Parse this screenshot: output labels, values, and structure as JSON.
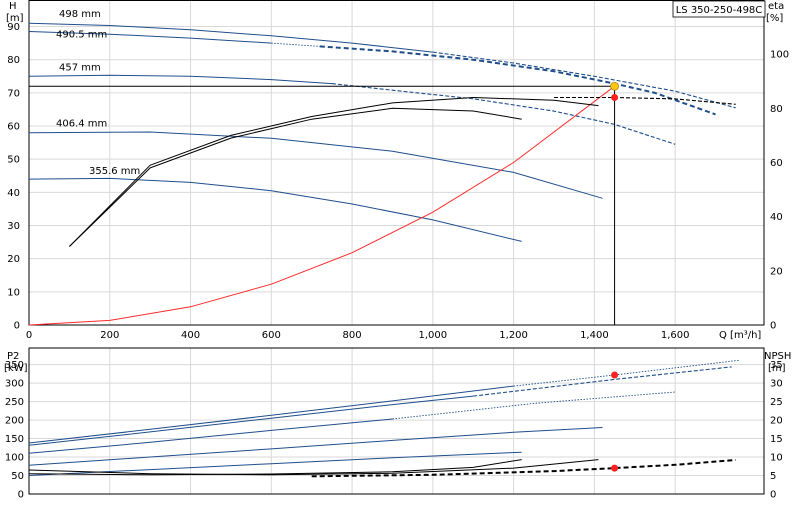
{
  "chart_data": [
    {
      "type": "line",
      "title": "LS 350-250-498C",
      "xlabel": "Q [m³/h]",
      "ylabel_left": {
        "name": "H",
        "unit": "[m]"
      },
      "ylabel_right": {
        "name": "eta",
        "unit": "[%]"
      },
      "xlim": [
        0,
        1820
      ],
      "ylim_left": [
        0,
        98
      ],
      "ylim_right": [
        0,
        120
      ],
      "x_ticks": [
        0,
        200,
        400,
        600,
        800,
        1000,
        1200,
        1400,
        1600
      ],
      "x_tick_labels": [
        "0",
        "200",
        "400",
        "600",
        "800",
        "1,000",
        "1,200",
        "1,400",
        "1,600"
      ],
      "y_ticks_left": [
        0,
        10,
        20,
        30,
        40,
        50,
        60,
        70,
        80,
        90
      ],
      "y_ticks_right": [
        0,
        20,
        40,
        60,
        80,
        100
      ],
      "grid": true,
      "duty_point": {
        "q": 1450,
        "h": 72,
        "eta": 84
      },
      "series": [
        {
          "name": "498 mm",
          "axis": "left",
          "color": "#1f4e8c",
          "style": "solid",
          "x": [
            0,
            200,
            400,
            600,
            800,
            1000
          ],
          "y": [
            91,
            90.3,
            89,
            87.2,
            85,
            82.3
          ]
        },
        {
          "name": "",
          "axis": "left",
          "color": "#1f4e8c",
          "style": "dashed",
          "x": [
            1000,
            1200,
            1400,
            1600,
            1750
          ],
          "y": [
            82.3,
            79,
            75,
            70.5,
            65.5
          ]
        },
        {
          "name": "490.5 mm",
          "axis": "left",
          "color": "#1f4e8c",
          "style": "solid",
          "x": [
            0,
            200,
            400,
            600
          ],
          "y": [
            88.5,
            87.7,
            86.5,
            85
          ]
        },
        {
          "name": "",
          "axis": "left",
          "color": "#1f4e8c",
          "style": "dotted",
          "x": [
            600,
            720
          ],
          "y": [
            85,
            84
          ]
        },
        {
          "name": "",
          "axis": "left",
          "color": "#1f4e8c",
          "style": "dashed-bold",
          "x": [
            720,
            900,
            1100,
            1300,
            1450,
            1550,
            1700
          ],
          "y": [
            84,
            82.5,
            80,
            76.5,
            72.8,
            70,
            63.5
          ]
        },
        {
          "name": "457 mm",
          "axis": "left",
          "color": "#1f4e8c",
          "style": "solid",
          "x": [
            0,
            200,
            400,
            600,
            750
          ],
          "y": [
            75,
            75.3,
            75,
            74,
            72.8
          ]
        },
        {
          "name": "",
          "axis": "left",
          "color": "#1f4e8c",
          "style": "dashed",
          "x": [
            750,
            900,
            1100,
            1300,
            1450,
            1600
          ],
          "y": [
            72.8,
            70.8,
            68.2,
            64.5,
            60.5,
            54.5
          ]
        },
        {
          "name": "406.4 mm",
          "axis": "left",
          "color": "#1f4e8c",
          "style": "solid",
          "x": [
            0,
            300,
            600,
            900,
            1200,
            1420
          ],
          "y": [
            58,
            58.2,
            56.3,
            52.4,
            46,
            38.2
          ]
        },
        {
          "name": "355.6 mm",
          "axis": "left",
          "color": "#1f4e8c",
          "style": "solid",
          "x": [
            0,
            200,
            400,
            600,
            800,
            1000,
            1220
          ],
          "y": [
            44,
            44.2,
            43,
            40.5,
            36.5,
            31.7,
            25.2
          ]
        },
        {
          "name": "",
          "axis": "left",
          "color": "#000000",
          "style": "solid",
          "x": [
            0,
            200,
            400,
            600,
            800,
            1000,
            1200,
            1300,
            1400,
            1450
          ],
          "y": [
            72,
            72,
            72,
            72,
            72,
            72,
            72,
            72,
            72,
            72
          ]
        },
        {
          "name": "",
          "axis": "left",
          "color": "#ff2a2a",
          "style": "solid",
          "x": [
            0,
            200,
            400,
            600,
            800,
            1000,
            1200,
            1450
          ],
          "y": [
            0,
            1.4,
            5.5,
            12.3,
            21.8,
            34,
            49,
            72
          ]
        },
        {
          "name": "",
          "axis": "right",
          "color": "#000000",
          "style": "solid",
          "x": [
            100,
            300,
            500,
            700,
            900,
            1100,
            1300,
            1410
          ],
          "y": [
            29,
            59,
            70,
            77,
            82,
            84,
            83,
            81
          ]
        },
        {
          "name": "",
          "axis": "right",
          "color": "#000000",
          "style": "solid",
          "x": [
            100,
            300,
            500,
            700,
            900,
            1100,
            1220
          ],
          "y": [
            29,
            58,
            69,
            76,
            80,
            79,
            76
          ]
        },
        {
          "name": "",
          "axis": "right",
          "color": "#000000",
          "style": "dashed",
          "x": [
            1300,
            1450,
            1600,
            1750
          ],
          "y": [
            84,
            84,
            83.5,
            81.5
          ]
        }
      ]
    },
    {
      "type": "line",
      "xlabel": "",
      "ylabel_left": {
        "name": "P2",
        "unit": "[kW]"
      },
      "ylabel_right": {
        "name": "NPSH",
        "unit": "[m]"
      },
      "xlim": [
        0,
        1820
      ],
      "ylim_left": [
        0,
        395
      ],
      "ylim_right": [
        0,
        39.5
      ],
      "y_ticks_left": [
        0,
        50,
        100,
        150,
        200,
        250,
        300,
        350
      ],
      "y_ticks_right": [
        0,
        5,
        10,
        15,
        20,
        25,
        30,
        35
      ],
      "grid": true,
      "duty_point": {
        "q": 1450,
        "p2": 322,
        "npsh": 7
      },
      "series": [
        {
          "name": "",
          "axis": "left",
          "color": "#1f4e8c",
          "style": "solid",
          "x": [
            0,
            300,
            600,
            900,
            1200
          ],
          "y": [
            138,
            175,
            213,
            252,
            292
          ]
        },
        {
          "name": "",
          "axis": "left",
          "color": "#1f4e8c",
          "style": "dotted",
          "x": [
            1200,
            1450,
            1760
          ],
          "y": [
            292,
            322,
            362
          ]
        },
        {
          "name": "",
          "axis": "left",
          "color": "#1f4e8c",
          "style": "solid",
          "x": [
            0,
            300,
            600,
            900,
            1100
          ],
          "y": [
            132,
            168,
            205,
            242,
            265
          ]
        },
        {
          "name": "",
          "axis": "left",
          "color": "#1f4e8c",
          "style": "dashed",
          "x": [
            1100,
            1450,
            1740
          ],
          "y": [
            265,
            310,
            344
          ]
        },
        {
          "name": "",
          "axis": "left",
          "color": "#1f4e8c",
          "style": "solid",
          "x": [
            0,
            300,
            600,
            900
          ],
          "y": [
            110,
            140,
            172,
            203
          ]
        },
        {
          "name": "",
          "axis": "left",
          "color": "#1f4e8c",
          "style": "dotted",
          "x": [
            900,
            1250,
            1600
          ],
          "y": [
            203,
            245,
            276
          ]
        },
        {
          "name": "",
          "axis": "left",
          "color": "#1f4e8c",
          "style": "solid",
          "x": [
            0,
            300,
            600,
            900,
            1200,
            1420
          ],
          "y": [
            78,
            100,
            122,
            145,
            167,
            180
          ]
        },
        {
          "name": "",
          "axis": "left",
          "color": "#1f4e8c",
          "style": "solid",
          "x": [
            0,
            300,
            600,
            900,
            1220
          ],
          "y": [
            50,
            66,
            82,
            98,
            113
          ]
        },
        {
          "name": "",
          "axis": "right",
          "color": "#000000",
          "style": "solid",
          "x": [
            0,
            300,
            600,
            900,
            1100,
            1220
          ],
          "y": [
            5.5,
            5.2,
            5.4,
            6,
            7.2,
            9.3
          ]
        },
        {
          "name": "",
          "axis": "right",
          "color": "#000000",
          "style": "solid",
          "x": [
            0,
            300,
            600,
            900,
            1200,
            1410
          ],
          "y": [
            6.5,
            5.5,
            5.2,
            5.6,
            7,
            9.3
          ]
        },
        {
          "name": "",
          "axis": "right",
          "color": "#000000",
          "style": "dashed-bold",
          "x": [
            700,
            1000,
            1300,
            1450,
            1600,
            1750
          ],
          "y": [
            4.8,
            5.2,
            6.2,
            7,
            7.9,
            9.2
          ]
        }
      ]
    }
  ]
}
